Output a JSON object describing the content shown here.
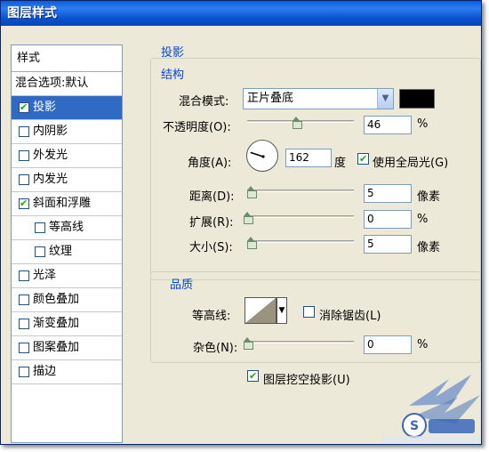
{
  "window": {
    "title": "图层样式"
  },
  "styles_list": {
    "header": "样式",
    "items": [
      {
        "label": "混合选项:默认",
        "type": "blend"
      },
      {
        "label": "投影",
        "checked": true,
        "selected": true
      },
      {
        "label": "内阴影",
        "checked": false
      },
      {
        "label": "外发光",
        "checked": false
      },
      {
        "label": "内发光",
        "checked": false
      },
      {
        "label": "斜面和浮雕",
        "checked": true
      },
      {
        "label": "等高线",
        "checked": false,
        "sub": true
      },
      {
        "label": "纹理",
        "checked": false,
        "sub": true
      },
      {
        "label": "光泽",
        "checked": false
      },
      {
        "label": "颜色叠加",
        "checked": false
      },
      {
        "label": "渐变叠加",
        "checked": false
      },
      {
        "label": "图案叠加",
        "checked": false
      },
      {
        "label": "描边",
        "checked": false
      }
    ]
  },
  "drop_shadow": {
    "title": "投影",
    "structure": {
      "title": "结构",
      "blend_mode_label": "混合模式:",
      "blend_mode_value": "正片叠底",
      "blend_color": "#000000",
      "opacity_label": "不透明度(O):",
      "opacity_value": "46",
      "opacity_unit": "%",
      "opacity_level": 46,
      "angle_label": "角度(A):",
      "angle_value": "162",
      "angle_unit": "度",
      "global_light_label": "使用全局光(G)",
      "global_light_checked": true,
      "distance_label": "距离(D):",
      "distance_value": "5",
      "distance_unit": "像素",
      "spread_label": "扩展(R):",
      "spread_value": "0",
      "spread_unit": "%",
      "size_label": "大小(S):",
      "size_value": "5",
      "size_unit": "像素"
    },
    "quality": {
      "title": "品质",
      "contour_label": "等高线:",
      "antialias_label": "消除锯齿(L)",
      "antialias_checked": false,
      "noise_label": "杂色(N):",
      "noise_value": "0",
      "noise_unit": "%"
    },
    "knockout_label": "图层挖空投影(U)",
    "knockout_checked": true
  }
}
